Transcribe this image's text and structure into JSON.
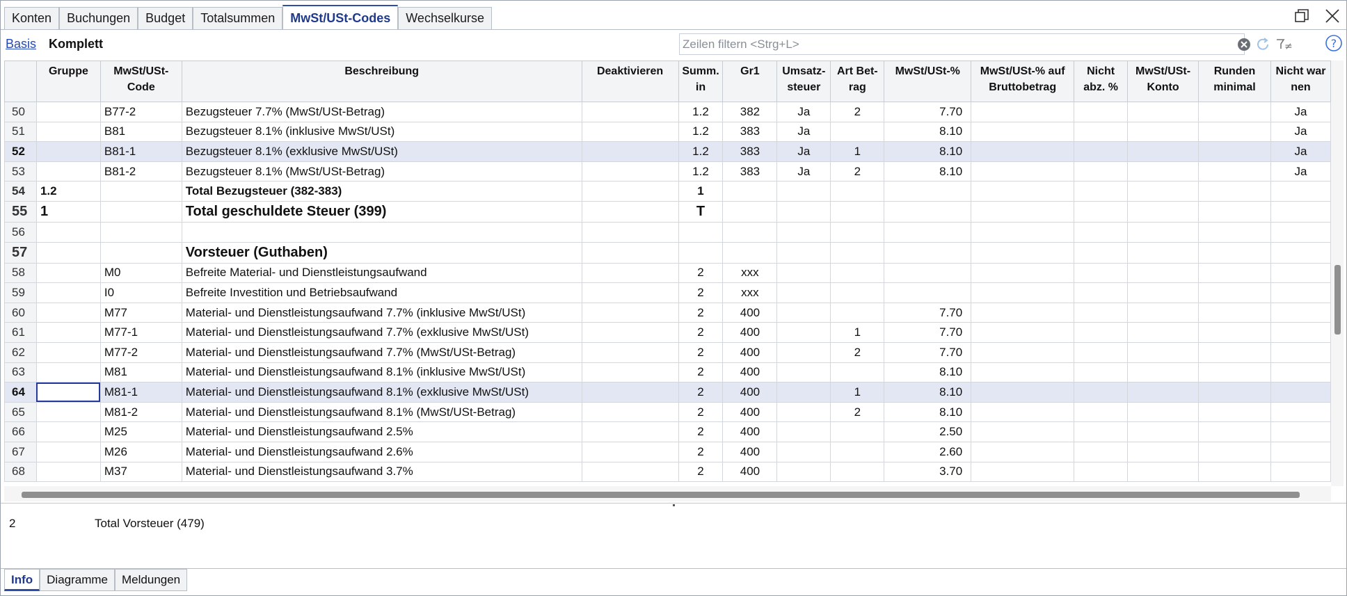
{
  "tabs": [
    "Konten",
    "Buchungen",
    "Budget",
    "Totalsummen",
    "MwSt/USt-Codes",
    "Wechselkurse"
  ],
  "views": {
    "basis": "Basis",
    "komplett": "Komplett"
  },
  "filter": {
    "placeholder": "Zeilen filtern <Strg+L>"
  },
  "columns": [
    {
      "key": "gruppe",
      "lines": [
        "Gruppe"
      ]
    },
    {
      "key": "code",
      "lines": [
        "MwSt/USt-",
        "Code"
      ]
    },
    {
      "key": "beschreibung",
      "lines": [
        "Beschreibung"
      ]
    },
    {
      "key": "deaktivieren",
      "lines": [
        "Deaktivieren"
      ]
    },
    {
      "key": "summ",
      "lines": [
        "Summ.",
        "in"
      ]
    },
    {
      "key": "gr1",
      "lines": [
        "Gr1"
      ]
    },
    {
      "key": "umsatz",
      "lines": [
        "Umsatz-",
        "steuer"
      ]
    },
    {
      "key": "art",
      "lines": [
        "Art Bet-",
        "rag"
      ]
    },
    {
      "key": "pct",
      "lines": [
        "MwSt/USt-%"
      ]
    },
    {
      "key": "brutto",
      "lines": [
        "MwSt/USt-% auf",
        "Bruttobetrag"
      ]
    },
    {
      "key": "nichtabz",
      "lines": [
        "Nicht",
        "abz. %"
      ]
    },
    {
      "key": "konto",
      "lines": [
        "MwSt/USt-",
        "Konto"
      ]
    },
    {
      "key": "runden",
      "lines": [
        "Runden",
        "minimal"
      ]
    },
    {
      "key": "nichtwarnen",
      "lines": [
        "Nicht war",
        "nen"
      ]
    }
  ],
  "rows": [
    {
      "n": "50",
      "gruppe": "",
      "code": "B77-2",
      "beschreibung": "Bezugsteuer 7.7%  (MwSt/USt-Betrag)",
      "summ": "1.2",
      "gr1": "382",
      "umsatz": "Ja",
      "art": "2",
      "pct": "7.70",
      "nichtwarnen": "Ja"
    },
    {
      "n": "51",
      "gruppe": "",
      "code": "B81",
      "beschreibung": "Bezugsteuer 8.1%  (inklusive MwSt/USt)",
      "summ": "1.2",
      "gr1": "383",
      "umsatz": "Ja",
      "art": "",
      "pct": "8.10",
      "nichtwarnen": "Ja"
    },
    {
      "n": "52",
      "gruppe": "",
      "code": "B81-1",
      "beschreibung": "Bezugsteuer 8.1%  (exklusive MwSt/USt)",
      "summ": "1.2",
      "gr1": "383",
      "umsatz": "Ja",
      "art": "1",
      "pct": "8.10",
      "nichtwarnen": "Ja",
      "selected": true
    },
    {
      "n": "53",
      "gruppe": "",
      "code": "B81-2",
      "beschreibung": "Bezugsteuer 8.1%  (MwSt/USt-Betrag)",
      "summ": "1.2",
      "gr1": "383",
      "umsatz": "Ja",
      "art": "2",
      "pct": "8.10",
      "nichtwarnen": "Ja"
    },
    {
      "n": "54",
      "gruppe": "1.2",
      "code": "",
      "beschreibung": "Total Bezugsteuer (382-383)",
      "summ": "1",
      "gr1": "",
      "umsatz": "",
      "art": "",
      "pct": "",
      "nichtwarnen": "",
      "style": "bold"
    },
    {
      "n": "55",
      "gruppe": "1",
      "code": "",
      "beschreibung": "Total geschuldete Steuer (399)",
      "summ": "T",
      "gr1": "",
      "umsatz": "",
      "art": "",
      "pct": "",
      "nichtwarnen": "",
      "style": "big"
    },
    {
      "n": "56",
      "gruppe": "",
      "code": "",
      "beschreibung": "",
      "summ": "",
      "gr1": "",
      "umsatz": "",
      "art": "",
      "pct": "",
      "nichtwarnen": ""
    },
    {
      "n": "57",
      "gruppe": "",
      "code": "",
      "beschreibung": "Vorsteuer (Guthaben)",
      "summ": "",
      "gr1": "",
      "umsatz": "",
      "art": "",
      "pct": "",
      "nichtwarnen": "",
      "style": "big"
    },
    {
      "n": "58",
      "gruppe": "",
      "code": "M0",
      "beschreibung": "Befreite Material- und Dienstleistungsaufwand",
      "summ": "2",
      "gr1": "xxx",
      "umsatz": "",
      "art": "",
      "pct": "",
      "nichtwarnen": ""
    },
    {
      "n": "59",
      "gruppe": "",
      "code": "I0",
      "beschreibung": "Befreite Investition und Betriebsaufwand",
      "summ": "2",
      "gr1": "xxx",
      "umsatz": "",
      "art": "",
      "pct": "",
      "nichtwarnen": ""
    },
    {
      "n": "60",
      "gruppe": "",
      "code": "M77",
      "beschreibung": "Material- und Dienstleistungsaufwand 7.7%  (inklusive MwSt/USt)",
      "summ": "2",
      "gr1": "400",
      "umsatz": "",
      "art": "",
      "pct": "7.70",
      "nichtwarnen": ""
    },
    {
      "n": "61",
      "gruppe": "",
      "code": "M77-1",
      "beschreibung": "Material- und Dienstleistungsaufwand 7.7%  (exklusive MwSt/USt)",
      "summ": "2",
      "gr1": "400",
      "umsatz": "",
      "art": "1",
      "pct": "7.70",
      "nichtwarnen": ""
    },
    {
      "n": "62",
      "gruppe": "",
      "code": "M77-2",
      "beschreibung": "Material- und Dienstleistungsaufwand 7.7%  (MwSt/USt-Betrag)",
      "summ": "2",
      "gr1": "400",
      "umsatz": "",
      "art": "2",
      "pct": "7.70",
      "nichtwarnen": ""
    },
    {
      "n": "63",
      "gruppe": "",
      "code": "M81",
      "beschreibung": "Material- und Dienstleistungsaufwand 8.1%  (inklusive MwSt/USt)",
      "summ": "2",
      "gr1": "400",
      "umsatz": "",
      "art": "",
      "pct": "8.10",
      "nichtwarnen": ""
    },
    {
      "n": "64",
      "gruppe": "",
      "code": "M81-1",
      "beschreibung": "Material- und Dienstleistungsaufwand 8.1%  (exklusive MwSt/USt)",
      "summ": "2",
      "gr1": "400",
      "umsatz": "",
      "art": "1",
      "pct": "8.10",
      "nichtwarnen": "",
      "selected": true,
      "cursor": true
    },
    {
      "n": "65",
      "gruppe": "",
      "code": "M81-2",
      "beschreibung": "Material- und Dienstleistungsaufwand 8.1%  (MwSt/USt-Betrag)",
      "summ": "2",
      "gr1": "400",
      "umsatz": "",
      "art": "2",
      "pct": "8.10",
      "nichtwarnen": ""
    },
    {
      "n": "66",
      "gruppe": "",
      "code": "M25",
      "beschreibung": "Material- und Dienstleistungsaufwand 2.5%",
      "summ": "2",
      "gr1": "400",
      "umsatz": "",
      "art": "",
      "pct": "2.50",
      "nichtwarnen": ""
    },
    {
      "n": "67",
      "gruppe": "",
      "code": "M26",
      "beschreibung": "Material- und Dienstleistungsaufwand 2.6%",
      "summ": "2",
      "gr1": "400",
      "umsatz": "",
      "art": "",
      "pct": "2.60",
      "nichtwarnen": ""
    },
    {
      "n": "68",
      "gruppe": "",
      "code": "M37",
      "beschreibung": "Material- und Dienstleistungsaufwand 3.7%",
      "summ": "2",
      "gr1": "400",
      "umsatz": "",
      "art": "",
      "pct": "3.70",
      "nichtwarnen": ""
    }
  ],
  "info": {
    "group": "2",
    "description": "Total Vorsteuer (479)"
  },
  "bottom_tabs": [
    "Info",
    "Diagramme",
    "Meldungen"
  ],
  "icons": {
    "restore": "restore-window-icon",
    "close": "close-icon",
    "clear": "clear-filter-icon",
    "refresh": "refresh-icon",
    "filter_options": "filter-options-icon",
    "help": "help-icon"
  },
  "colors": {
    "accent": "#2b4ca8",
    "selected_row": "#e3e6f3",
    "header_bg": "#f3f4f6"
  }
}
